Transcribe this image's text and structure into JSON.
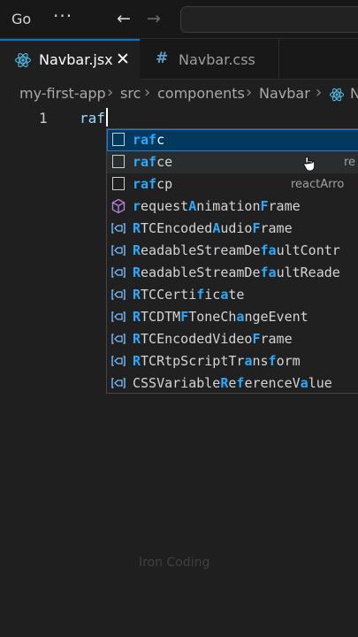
{
  "titlebar": {
    "menu": "Go",
    "more_glyph": "···",
    "back_glyph": "←",
    "forward_glyph": "→"
  },
  "tabs": [
    {
      "label": "Navbar.jsx",
      "icon": "react-icon",
      "close_glyph": "✕"
    },
    {
      "label": "Navbar.css",
      "icon_glyph": "#"
    }
  ],
  "breadcrumb": {
    "items": [
      "my-first-app",
      "src",
      "components",
      "Navbar",
      "N"
    ],
    "separator": "›"
  },
  "editor": {
    "line_number": "1",
    "line_text": "raf"
  },
  "suggestions": [
    {
      "icon": "snippet",
      "parts": [
        {
          "t": "raf",
          "m": 1
        },
        {
          "t": "c",
          "m": 0
        }
      ],
      "detail": "",
      "state": "selected"
    },
    {
      "icon": "snippet",
      "parts": [
        {
          "t": "raf",
          "m": 1
        },
        {
          "t": "ce",
          "m": 0
        }
      ],
      "detail": "re",
      "state": "hovered"
    },
    {
      "icon": "snippet",
      "parts": [
        {
          "t": "raf",
          "m": 1
        },
        {
          "t": "cp",
          "m": 0
        }
      ],
      "detail": "reactArro",
      "state": ""
    },
    {
      "icon": "method",
      "parts": [
        {
          "t": "r",
          "m": 1
        },
        {
          "t": "equest",
          "m": 0
        },
        {
          "t": "A",
          "m": 1
        },
        {
          "t": "nimation",
          "m": 0
        },
        {
          "t": "F",
          "m": 1
        },
        {
          "t": "rame",
          "m": 0
        }
      ],
      "detail": "",
      "state": ""
    },
    {
      "icon": "variable",
      "parts": [
        {
          "t": "R",
          "m": 1
        },
        {
          "t": "TCEncoded",
          "m": 0
        },
        {
          "t": "A",
          "m": 1
        },
        {
          "t": "udio",
          "m": 0
        },
        {
          "t": "F",
          "m": 1
        },
        {
          "t": "rame",
          "m": 0
        }
      ],
      "detail": "",
      "state": ""
    },
    {
      "icon": "variable",
      "parts": [
        {
          "t": "R",
          "m": 1
        },
        {
          "t": "eadableStreamDe",
          "m": 0
        },
        {
          "t": "fa",
          "m": 1
        },
        {
          "t": "ultContr",
          "m": 0
        }
      ],
      "detail": "",
      "state": ""
    },
    {
      "icon": "variable",
      "parts": [
        {
          "t": "R",
          "m": 1
        },
        {
          "t": "eadableStreamDe",
          "m": 0
        },
        {
          "t": "fa",
          "m": 1
        },
        {
          "t": "ultReade",
          "m": 0
        }
      ],
      "detail": "",
      "state": ""
    },
    {
      "icon": "variable",
      "parts": [
        {
          "t": "R",
          "m": 1
        },
        {
          "t": "TCCerti",
          "m": 0
        },
        {
          "t": "f",
          "m": 1
        },
        {
          "t": "ic",
          "m": 0
        },
        {
          "t": "a",
          "m": 1
        },
        {
          "t": "te",
          "m": 0
        }
      ],
      "detail": "",
      "state": ""
    },
    {
      "icon": "variable",
      "parts": [
        {
          "t": "R",
          "m": 1
        },
        {
          "t": "TCDTM",
          "m": 0
        },
        {
          "t": "F",
          "m": 1
        },
        {
          "t": "ToneCh",
          "m": 0
        },
        {
          "t": "a",
          "m": 1
        },
        {
          "t": "ngeEvent",
          "m": 0
        }
      ],
      "detail": "",
      "state": ""
    },
    {
      "icon": "variable",
      "parts": [
        {
          "t": "R",
          "m": 1
        },
        {
          "t": "TCEncodedVideo",
          "m": 0
        },
        {
          "t": "F",
          "m": 1
        },
        {
          "t": "rame",
          "m": 0
        }
      ],
      "detail": "",
      "state": ""
    },
    {
      "icon": "variable",
      "parts": [
        {
          "t": "R",
          "m": 1
        },
        {
          "t": "TCRtpScriptTr",
          "m": 0
        },
        {
          "t": "a",
          "m": 1
        },
        {
          "t": "ns",
          "m": 0
        },
        {
          "t": "f",
          "m": 1
        },
        {
          "t": "orm",
          "m": 0
        }
      ],
      "detail": "",
      "state": ""
    },
    {
      "icon": "variable",
      "parts": [
        {
          "t": "CSSVariable",
          "m": 0
        },
        {
          "t": "R",
          "m": 1
        },
        {
          "t": "e",
          "m": 0
        },
        {
          "t": "f",
          "m": 1
        },
        {
          "t": "erenceV",
          "m": 0
        },
        {
          "t": "a",
          "m": 1
        },
        {
          "t": "lue",
          "m": 0
        }
      ],
      "detail": "",
      "state": ""
    }
  ],
  "watermark": "Iron Coding",
  "colors": {
    "accent": "#0078d4",
    "match": "#2aaaff",
    "selected_bg": "#04395e",
    "react": "#4fb9e3",
    "method": "#b180d7"
  }
}
